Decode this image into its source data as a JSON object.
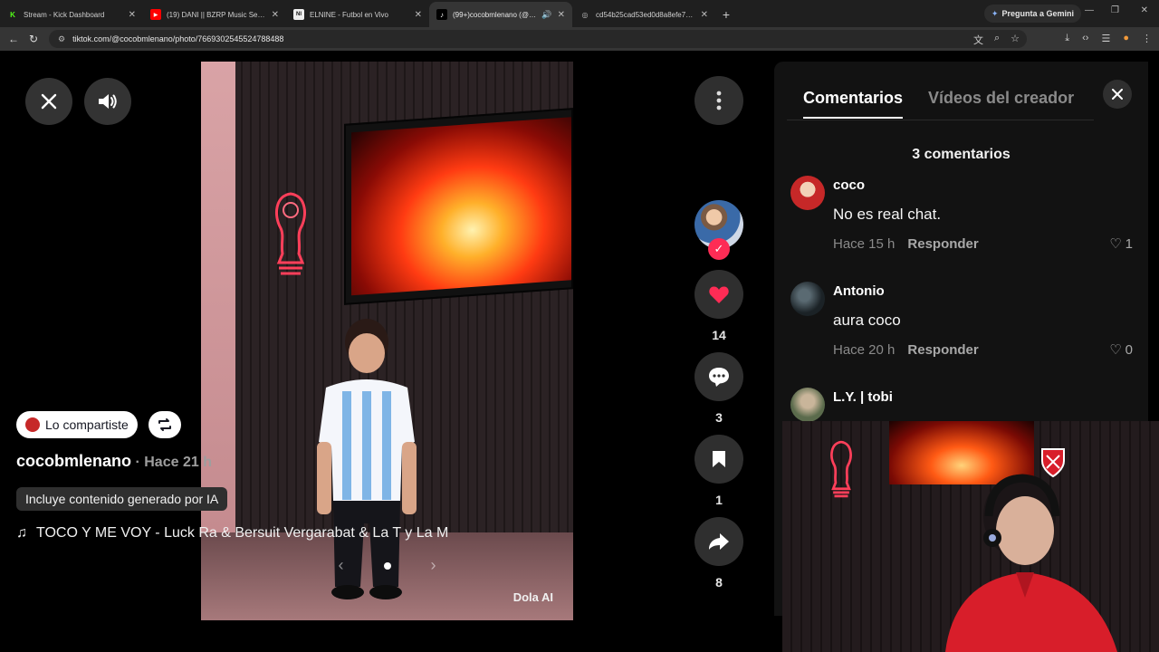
{
  "browser": {
    "tabs": [
      {
        "title": "Stream - Kick Dashboard",
        "favicon": "K",
        "color": "#53fc18",
        "active": false
      },
      {
        "title": "(19) DANI || BZRP Music Sessio...",
        "favicon": "▶",
        "color": "#ff0000",
        "active": false
      },
      {
        "title": "ELNINE - Futbol en Vivo",
        "favicon": "NI",
        "color": "#111111",
        "active": false
      },
      {
        "title": "(99+)cocobmlenano (@coc...",
        "favicon": "♪",
        "color": "#000000",
        "active": true
      },
      {
        "title": "cd54b25cad53ed0d8a8efe7d5...",
        "favicon": "◎",
        "color": "#444444",
        "active": false
      }
    ],
    "new_tab_glyph": "+",
    "gemini_label": "Pregunta a Gemini",
    "url": "tiktok.com/@cocobmlenano/photo/7669302545524788488"
  },
  "viewer": {
    "close_icon": "close-icon",
    "volume_icon": "volume-icon",
    "shared_label": "Lo compartiste",
    "author": "cocobmlenano",
    "time_ago": " · Hace 21 h",
    "ai_badge": "Incluye contenido generado por IA",
    "music_glyph": "♫",
    "music": "TOCO Y ME VOY - Luck Ra & Bersuit Vergarabat & La T y La M",
    "watermark": "Dola AI",
    "likes": "14",
    "comments": "3",
    "saves": "1",
    "shares": "8"
  },
  "comments_panel": {
    "tab_comments": "Comentarios",
    "tab_creator_videos": "Vídeos del creador",
    "count_label": "3 comentarios",
    "comments": [
      {
        "user": "coco",
        "text": "No es real chat.",
        "time": "Hace 15 h",
        "reply": "Responder",
        "likes": "1",
        "avatar_color": "#c62828"
      },
      {
        "user": "Antonio",
        "text": "aura coco",
        "time": "Hace 20 h",
        "reply": "Responder",
        "likes": "0",
        "avatar_color": "#2b3338"
      },
      {
        "user": "L.Y. | tobi",
        "text": "",
        "time": "",
        "reply": "",
        "likes": "",
        "avatar_color": "#7a8f6a"
      }
    ]
  },
  "colors": {
    "accent": "#fe2c55",
    "panel_bg": "#121212"
  }
}
